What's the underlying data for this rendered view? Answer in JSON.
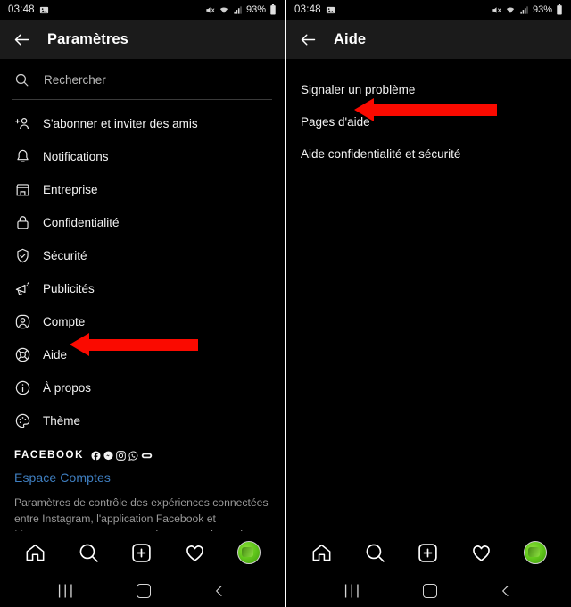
{
  "status_bar": {
    "time": "03:48",
    "battery_text": "93%",
    "icons": [
      "image-icon",
      "mute-icon",
      "wifi-icon",
      "signal-icon",
      "battery-icon"
    ]
  },
  "left_panel": {
    "header": {
      "back_label": "back-arrow",
      "title": "Paramètres"
    },
    "search": {
      "placeholder": "Rechercher",
      "value": ""
    },
    "items": [
      {
        "label": "S'abonner et inviter des amis",
        "icon": "add-person-icon"
      },
      {
        "label": "Notifications",
        "icon": "bell-icon"
      },
      {
        "label": "Entreprise",
        "icon": "store-icon"
      },
      {
        "label": "Confidentialité",
        "icon": "lock-icon"
      },
      {
        "label": "Sécurité",
        "icon": "shield-check-icon"
      },
      {
        "label": "Publicités",
        "icon": "megaphone-icon"
      },
      {
        "label": "Compte",
        "icon": "account-circle-icon"
      },
      {
        "label": "Aide",
        "icon": "lifebuoy-icon"
      },
      {
        "label": "À propos",
        "icon": "info-icon"
      },
      {
        "label": "Thème",
        "icon": "palette-icon"
      }
    ],
    "facebook": {
      "title": "FACEBOOK",
      "brand_icons": [
        "facebook-icon",
        "messenger-icon",
        "instagram-icon",
        "whatsapp-icon",
        "portal-icon"
      ],
      "link": "Espace Comptes",
      "description": "Paramètres de contrôle des expériences connectées entre Instagram, l'application Facebook et Messenger, notamment pour le partage de stories et de publications, et la connexion"
    },
    "annotation": {
      "target": "Aide",
      "color": "#fa0a00"
    }
  },
  "right_panel": {
    "header": {
      "back_label": "back-arrow",
      "title": "Aide"
    },
    "items": [
      {
        "label": "Signaler un problème"
      },
      {
        "label": "Pages d'aide"
      },
      {
        "label": "Aide confidentialité et sécurité"
      }
    ],
    "annotation": {
      "target": "Pages d'aide",
      "color": "#fa0a00"
    }
  },
  "bottom_nav": {
    "items": [
      "home-icon",
      "search-icon",
      "add-post-icon",
      "heart-icon",
      "profile-avatar"
    ]
  },
  "system_nav": {
    "items": [
      "recents-icon",
      "home-icon",
      "back-icon"
    ]
  },
  "colors": {
    "background": "#000000",
    "appbar": "#1b1b1b",
    "accent_link": "#3f7fc1",
    "annotation": "#fa0a00"
  }
}
